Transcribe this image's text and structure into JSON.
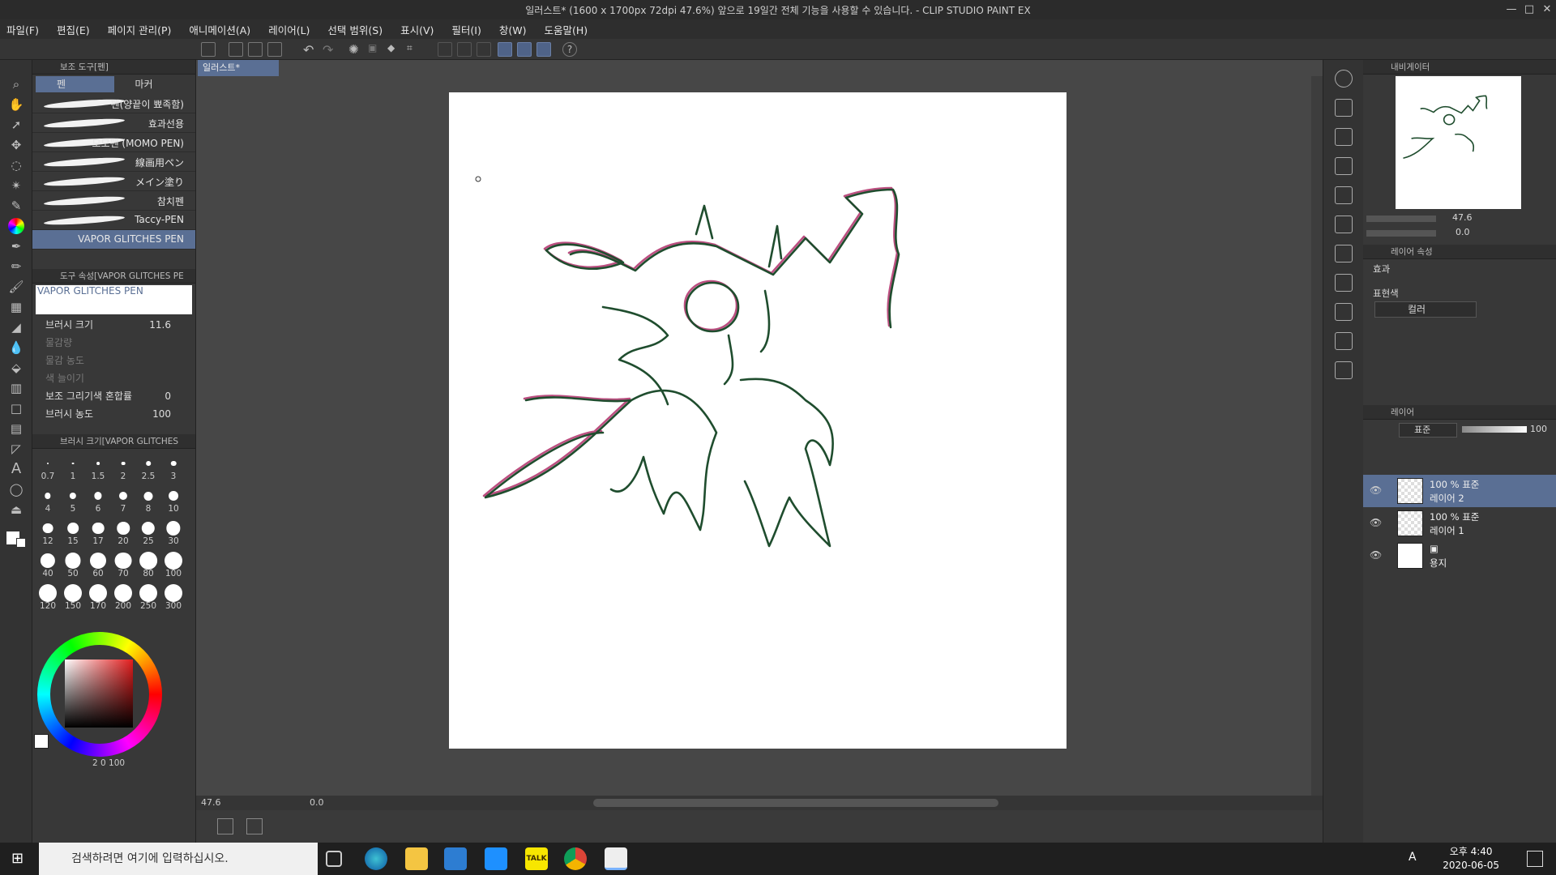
{
  "window": {
    "title": "일러스트* (1600 x 1700px 72dpi 47.6%)  앞으로 19일간 전체 기능을 사용할 수 있습니다. - CLIP STUDIO PAINT EX",
    "controls": [
      "—",
      "□",
      "✕"
    ]
  },
  "menu": [
    "파일(F)",
    "편집(E)",
    "페이지 관리(P)",
    "애니메이션(A)",
    "레이어(L)",
    "선택 범위(S)",
    "표시(V)",
    "필터(I)",
    "창(W)",
    "도움말(H)"
  ],
  "sub_tool_panel": {
    "header": "보조 도구[펜]",
    "tabs": [
      "펜",
      "마커"
    ],
    "brushes": [
      "펜(양끝이 뾰족함)",
      "효과선용",
      "모모펜 (MOMO PEN)",
      "線画用ペン",
      "メイン塗り",
      "참치펜",
      "Taccy-PEN",
      "VAPOR   GLITCHES   PEN"
    ]
  },
  "tool_property": {
    "header": "도구 속성[VAPOR   GLITCHES   PE",
    "brush_name": "VAPOR   GLITCHES   PEN",
    "rows": [
      {
        "label": "브러시 크기",
        "value": "11.6"
      },
      {
        "label": "물감량",
        "value": ""
      },
      {
        "label": "물감 농도",
        "value": ""
      },
      {
        "label": "색 늘이기",
        "value": ""
      },
      {
        "label": "보조 그리기색 혼합률",
        "value": "0"
      },
      {
        "label": "브러시 농도",
        "value": "100"
      }
    ]
  },
  "brush_size_panel": {
    "header": "브러시 크기[VAPOR   GLITCHES",
    "sizes": [
      "0.7",
      "1",
      "1.5",
      "2",
      "2.5",
      "3",
      "4",
      "5",
      "6",
      "7",
      "8",
      "10",
      "12",
      "15",
      "17",
      "20",
      "25",
      "30",
      "40",
      "50",
      "60",
      "70",
      "80",
      "100",
      "120",
      "150",
      "170",
      "200",
      "250",
      "300"
    ]
  },
  "color_panel": {
    "footer": "2    0    100"
  },
  "document": {
    "tab": "일러스트*",
    "zoom": "47.6",
    "rotation": "0.0"
  },
  "navigator": {
    "header": "내비게이터",
    "zoom": "47.6",
    "angle": "0.0"
  },
  "layer_property": {
    "header": "레이어 속성",
    "effect_label": "효과",
    "expression_label": "표현색",
    "expression_value": "컬러"
  },
  "layers_panel": {
    "header": "레이어",
    "blend_mode": "표준",
    "opacity": "100",
    "layers": [
      {
        "opacity_mode": "100 % 표준",
        "name": "레이어 2",
        "active": true
      },
      {
        "opacity_mode": "100 % 표준",
        "name": "레이어 1",
        "active": false
      },
      {
        "opacity_mode": "",
        "name": "용지",
        "active": false
      }
    ]
  },
  "taskbar": {
    "search_placeholder": "검색하려면 여기에 입력하십시오.",
    "time": "오후 4:40",
    "date": "2020-06-05",
    "ime": "A",
    "kakao": "TALK"
  },
  "colors": {
    "accent": "#5a6f94",
    "line_green": "#1f4d2e",
    "line_magenta": "#b0306a"
  }
}
